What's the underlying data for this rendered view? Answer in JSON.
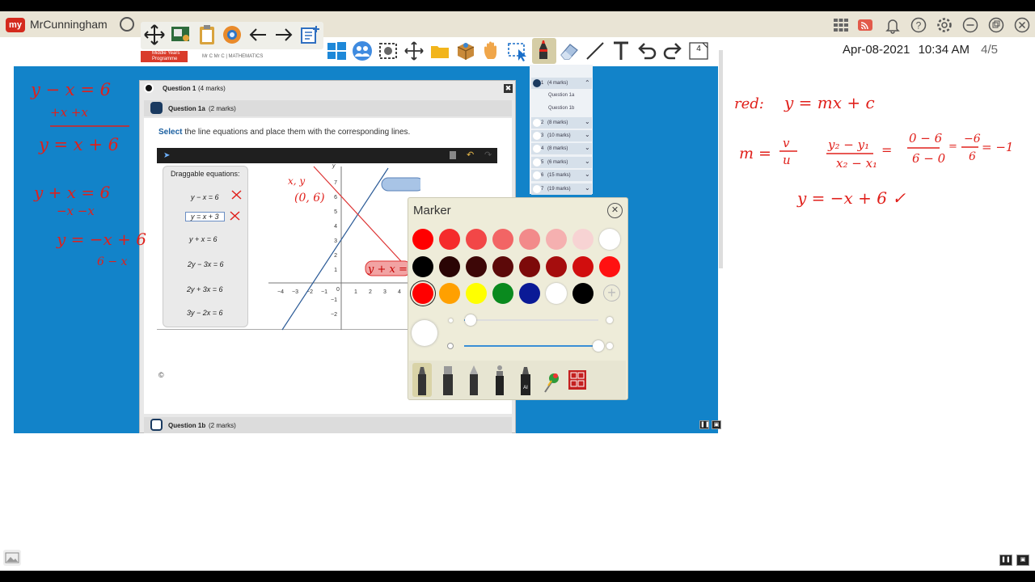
{
  "app": {
    "user_name": "MrCunningham",
    "logo_text": "my"
  },
  "clock": {
    "date": "Apr-08-2021",
    "time": "10:34 AM",
    "page": "4/5"
  },
  "toolbar": {
    "page_count": "4"
  },
  "question_panel": {
    "question_title": "Question 1",
    "question_marks": "(4 marks)",
    "close_label": "✖",
    "sub_title": "Question 1a",
    "sub_marks": "(2 marks)",
    "instruction_verb": "Select",
    "instruction_rest": " the line equations and place them with the corresponding lines.",
    "draggable_title": "Draggable equations:",
    "equations": [
      "y − x = 6",
      "y = x + 3",
      "y + x = 6",
      "2y − 3x = 6",
      "2y + 3x = 6",
      "3y − 2x = 6"
    ],
    "copyright": "©",
    "next_sub_title": "Question 1b",
    "next_sub_marks": "(2 marks)"
  },
  "program": {
    "ib_logo_text": "Middle Years Programme",
    "teacher_info": "Mr C Mr C   |   MATHEMATICS"
  },
  "graph": {
    "y_label": "y",
    "x_ticks": [
      "−4",
      "−3",
      "−2",
      "−1",
      "0",
      "1",
      "2",
      "3",
      "4"
    ],
    "y_ticks": [
      "7",
      "6",
      "5",
      "4",
      "3",
      "2",
      "1",
      "−1",
      "−2"
    ]
  },
  "nav": {
    "items": [
      {
        "num": "1",
        "marks": "(4 marks)"
      },
      {
        "num": "2",
        "marks": "(8 marks)"
      },
      {
        "num": "3",
        "marks": "(10 marks)"
      },
      {
        "num": "4",
        "marks": "(8 marks)"
      },
      {
        "num": "5",
        "marks": "(6 marks)"
      },
      {
        "num": "6",
        "marks": "(15 marks)"
      },
      {
        "num": "7",
        "marks": "(19 marks)"
      }
    ],
    "sub_items": [
      "Question 1a",
      "Question 1b"
    ]
  },
  "marker_panel": {
    "title": "Marker",
    "colors_row1": [
      "#ff0000",
      "#f52b2b",
      "#f24747",
      "#f26565",
      "#f28a8a",
      "#f5b0b0",
      "#f7d3d3",
      "#ffffff"
    ],
    "colors_row2": [
      "#000000",
      "#2a0505",
      "#3d0707",
      "#5c0909",
      "#7d0a0a",
      "#a50d0d",
      "#d10e0e",
      "#ff1111"
    ],
    "colors_row3": [
      "#ff0000",
      "#ffa000",
      "#ffff00",
      "#0a8a1e",
      "#0a1a96",
      "#ffffff",
      "#000000"
    ],
    "selected_color": "#ff0000",
    "thickness_level": 0.05,
    "opacity_level": 1.0,
    "add_label": "+"
  },
  "whiteboard_notes": {
    "n1": "y − x = 6",
    "n2": "+x      +x",
    "n3": "y = x + 6",
    "n4": "y + x = 6",
    "n5": "−x    −x",
    "n6": "y = −x + 6",
    "n7": "6 − x",
    "n8": "red:",
    "n9": "y = mx + c",
    "n10": "m =",
    "n11": "v",
    "n12": "u",
    "n13": "y₂ − y₁",
    "n14": "x₂ − x₁",
    "n15": "0 − 6",
    "n16": "6 − 0",
    "n17": "−6",
    "n18": "6",
    "n19": "= −1",
    "n20": "y = −x + 6 ✓",
    "n21": "x, y",
    "n22": "(0, 6)",
    "n23": "y + x = 6"
  }
}
